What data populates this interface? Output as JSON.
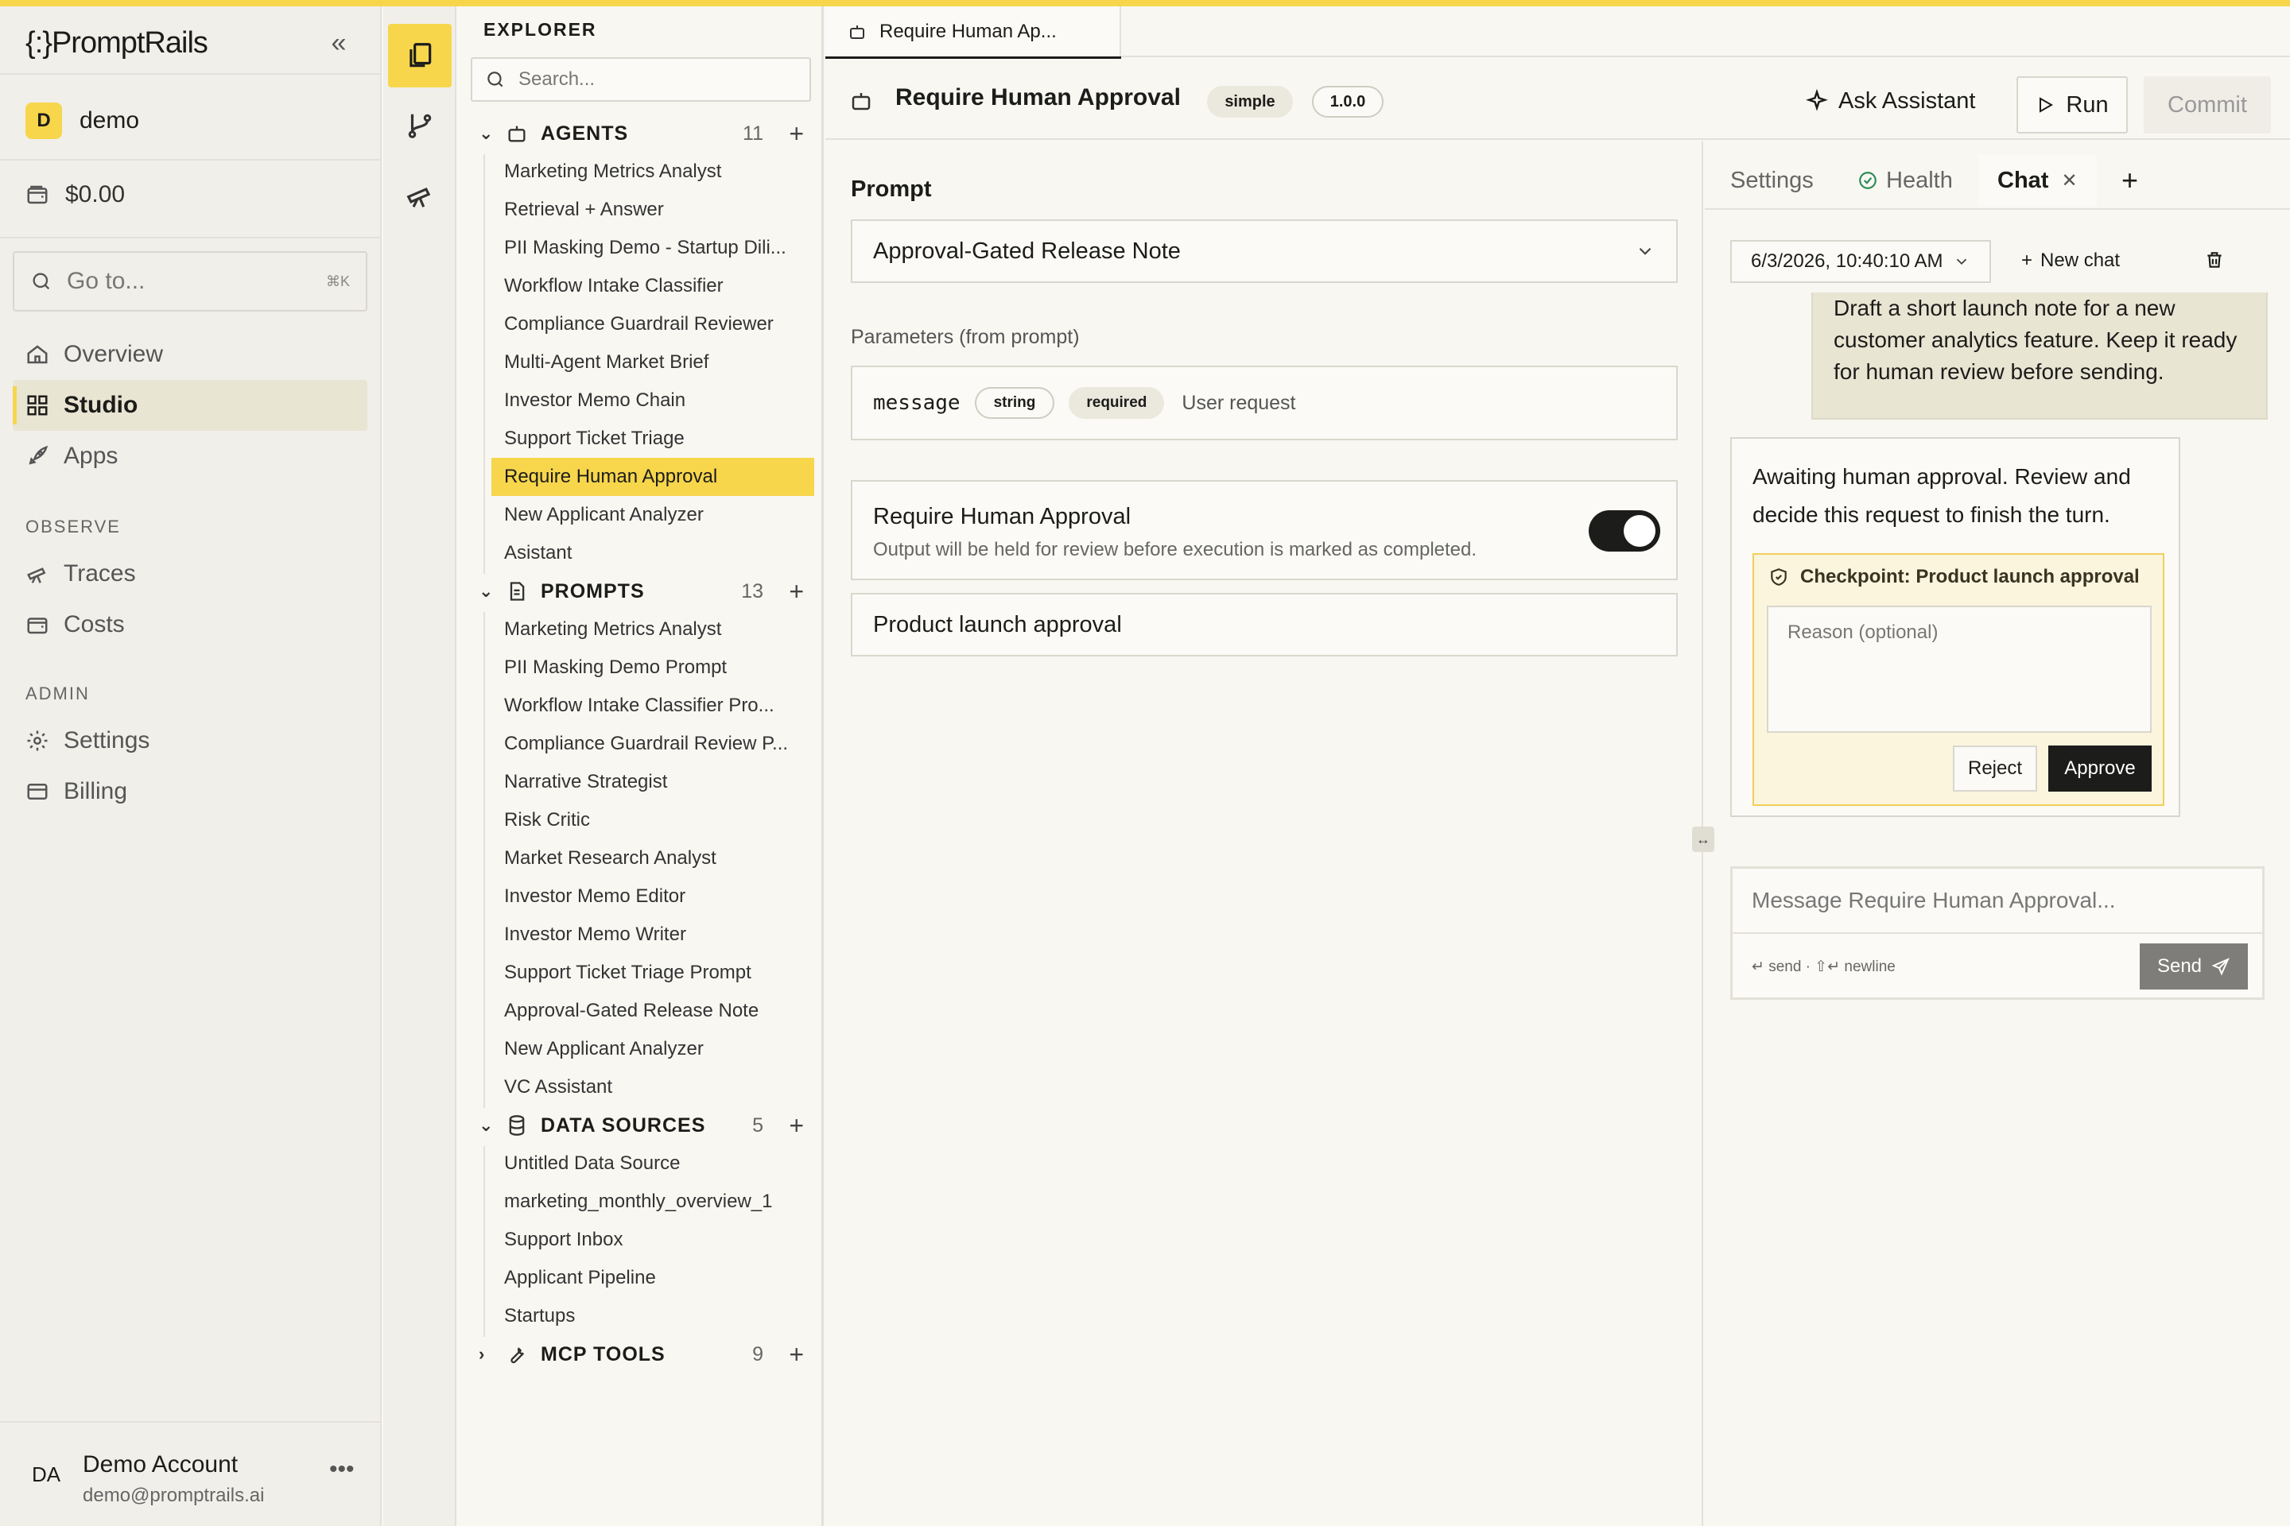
{
  "app": {
    "logo": "PromptRails"
  },
  "workspace": {
    "badge": "D",
    "name": "demo"
  },
  "credits": "$0.00",
  "goto": {
    "placeholder": "Go to...",
    "shortcut": "⌘K"
  },
  "nav": {
    "main": [
      {
        "label": "Overview",
        "icon": "home-icon"
      },
      {
        "label": "Studio",
        "icon": "grid-icon",
        "active": true
      },
      {
        "label": "Apps",
        "icon": "rocket-icon"
      }
    ],
    "observe_title": "OBSERVE",
    "observe": [
      {
        "label": "Traces",
        "icon": "telescope-icon"
      },
      {
        "label": "Costs",
        "icon": "wallet-icon"
      }
    ],
    "admin_title": "ADMIN",
    "admin": [
      {
        "label": "Settings",
        "icon": "gear-icon"
      },
      {
        "label": "Billing",
        "icon": "card-icon"
      }
    ]
  },
  "account": {
    "initials": "DA",
    "name": "Demo Account",
    "email": "demo@promptrails.ai"
  },
  "explorer": {
    "title": "EXPLORER",
    "search_placeholder": "Search...",
    "groups": [
      {
        "name": "AGENTS",
        "count": "11",
        "expanded": true,
        "items": [
          "Marketing Metrics Analyst",
          "Retrieval + Answer",
          "PII Masking Demo - Startup Dili...",
          "Workflow Intake Classifier",
          "Compliance Guardrail Reviewer",
          "Multi-Agent Market Brief",
          "Investor Memo Chain",
          "Support Ticket Triage",
          "Require Human Approval",
          "New Applicant Analyzer",
          "Asistant"
        ],
        "active_index": 8
      },
      {
        "name": "PROMPTS",
        "count": "13",
        "expanded": true,
        "items": [
          "Marketing Metrics Analyst",
          "PII Masking Demo Prompt",
          "Workflow Intake Classifier Pro...",
          "Compliance Guardrail Review P...",
          "Narrative Strategist",
          "Risk Critic",
          "Market Research Analyst",
          "Investor Memo Editor",
          "Investor Memo Writer",
          "Support Ticket Triage Prompt",
          "Approval-Gated Release Note",
          "New Applicant Analyzer",
          "VC Assistant"
        ]
      },
      {
        "name": "DATA SOURCES",
        "count": "5",
        "expanded": true,
        "items": [
          "Untitled Data Source",
          "marketing_monthly_overview_1",
          "Support Inbox",
          "Applicant Pipeline",
          "Startups"
        ]
      },
      {
        "name": "MCP TOOLS",
        "count": "9",
        "expanded": false,
        "items": []
      }
    ]
  },
  "tab": {
    "label": "Require Human Ap..."
  },
  "header": {
    "title": "Require Human Approval",
    "type_badge": "simple",
    "version_badge": "1.0.0",
    "ask_label": "Ask Assistant",
    "run_label": "Run",
    "commit_label": "Commit"
  },
  "editor": {
    "prompt_label": "Prompt",
    "prompt_value": "Approval-Gated Release Note",
    "params_label": "Parameters (from prompt)",
    "param": {
      "name": "message",
      "type": "string",
      "required": "required",
      "description": "User request"
    },
    "approval": {
      "title": "Require Human Approval",
      "subtitle": "Output will be held for review before execution is marked as completed.",
      "enabled": true
    },
    "checkpoint_value": "Product launch approval"
  },
  "right": {
    "tabs": {
      "settings": "Settings",
      "health": "Health",
      "chat": "Chat"
    },
    "session": "6/3/2026, 10:40:10 AM",
    "new_chat": "New chat",
    "user_message": "Draft a short launch note for a new customer analytics feature. Keep it ready for human review before sending.",
    "assistant_message": "Awaiting human approval. Review and decide this request to finish the turn.",
    "checkpoint": {
      "title": "Checkpoint: Product launch approval",
      "reason_placeholder": "Reason (optional)",
      "reject": "Reject",
      "approve": "Approve"
    },
    "composer": {
      "placeholder": "Message Require Human Approval...",
      "hint": "↵ send · ⇧↵ newline",
      "send": "Send"
    }
  },
  "colors": {
    "accent": "#f7d64c",
    "background": "#f8f7f2",
    "dark": "#1c1c1a",
    "health_ok": "#2e8b57"
  }
}
